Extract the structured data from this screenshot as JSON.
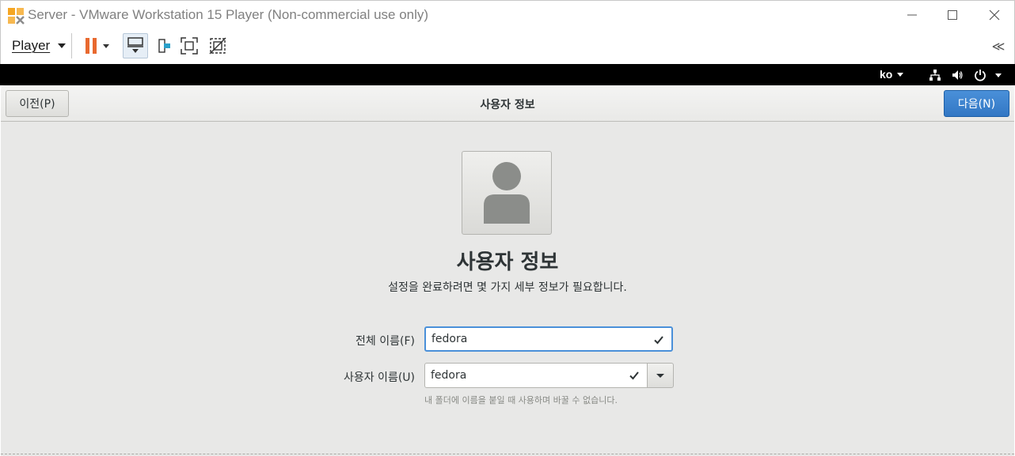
{
  "window": {
    "title": "Server - VMware Workstation 15 Player (Non-commercial use only)"
  },
  "toolbar": {
    "player_label": "Player",
    "icons": [
      "pause-icon",
      "send-ctrl-alt-del-icon",
      "removable-devices-icon",
      "full-screen-icon",
      "unity-icon"
    ],
    "collapse_label": "≪"
  },
  "topbar": {
    "language": "ko"
  },
  "header": {
    "prev_label": "이전(P)",
    "title": "사용자 정보",
    "next_label": "다음(N)"
  },
  "main": {
    "title": "사용자 정보",
    "subtitle": "설정을 완료하려면 몇 가지 세부 정보가 필요합니다.",
    "full_name_label": "전체 이름(F)",
    "full_name_value": "fedora",
    "username_label": "사용자 이름(U)",
    "username_value": "fedora",
    "hint": "내 폴더에 이름을 붙일 때 사용하며 바꿀 수 없습니다."
  },
  "colors": {
    "accent": "#3277c4",
    "pause": "#e8692f",
    "check": "#2e3436"
  }
}
